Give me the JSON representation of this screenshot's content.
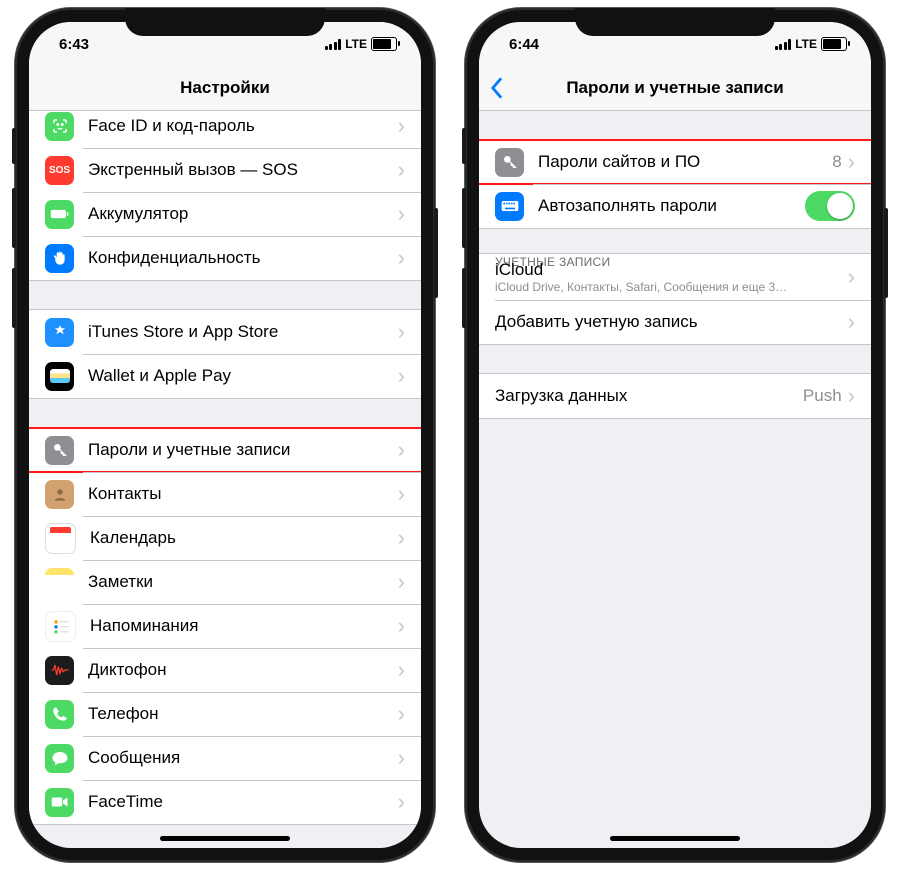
{
  "left": {
    "status": {
      "time": "6:43",
      "lte": "LTE"
    },
    "title": "Настройки",
    "groups": [
      {
        "items": [
          {
            "label": "Face ID и код-пароль",
            "icon": "faceid"
          },
          {
            "label": "Экстренный вызов — SOS",
            "icon": "sos",
            "icon_text": "SOS"
          },
          {
            "label": "Аккумулятор",
            "icon": "battery"
          },
          {
            "label": "Конфиденциальность",
            "icon": "privacy"
          }
        ]
      },
      {
        "items": [
          {
            "label": "iTunes Store и App Store",
            "icon": "appstore"
          },
          {
            "label": "Wallet и Apple Pay",
            "icon": "wallet"
          }
        ]
      },
      {
        "items": [
          {
            "label": "Пароли и учетные записи",
            "icon": "passwords",
            "highlight": true
          },
          {
            "label": "Контакты",
            "icon": "contacts"
          },
          {
            "label": "Календарь",
            "icon": "calendar"
          },
          {
            "label": "Заметки",
            "icon": "notes"
          },
          {
            "label": "Напоминания",
            "icon": "reminders"
          },
          {
            "label": "Диктофон",
            "icon": "voice"
          },
          {
            "label": "Телефон",
            "icon": "phone"
          },
          {
            "label": "Сообщения",
            "icon": "messages"
          },
          {
            "label": "FaceTime",
            "icon": "facetime"
          }
        ]
      }
    ]
  },
  "right": {
    "status": {
      "time": "6:44",
      "lte": "LTE"
    },
    "title": "Пароли и учетные записи",
    "passwords_row": {
      "label": "Пароли сайтов и ПО",
      "count": "8",
      "highlight": true
    },
    "autofill_row": {
      "label": "Автозаполнять пароли",
      "on": true
    },
    "accounts_header": "УЧЕТНЫЕ ЗАПИСИ",
    "accounts": [
      {
        "label": "iCloud",
        "subtitle": "iCloud Drive, Контакты, Safari, Сообщения и еще 3…"
      },
      {
        "label": "Добавить учетную запись"
      }
    ],
    "fetch_row": {
      "label": "Загрузка данных",
      "detail": "Push"
    }
  }
}
